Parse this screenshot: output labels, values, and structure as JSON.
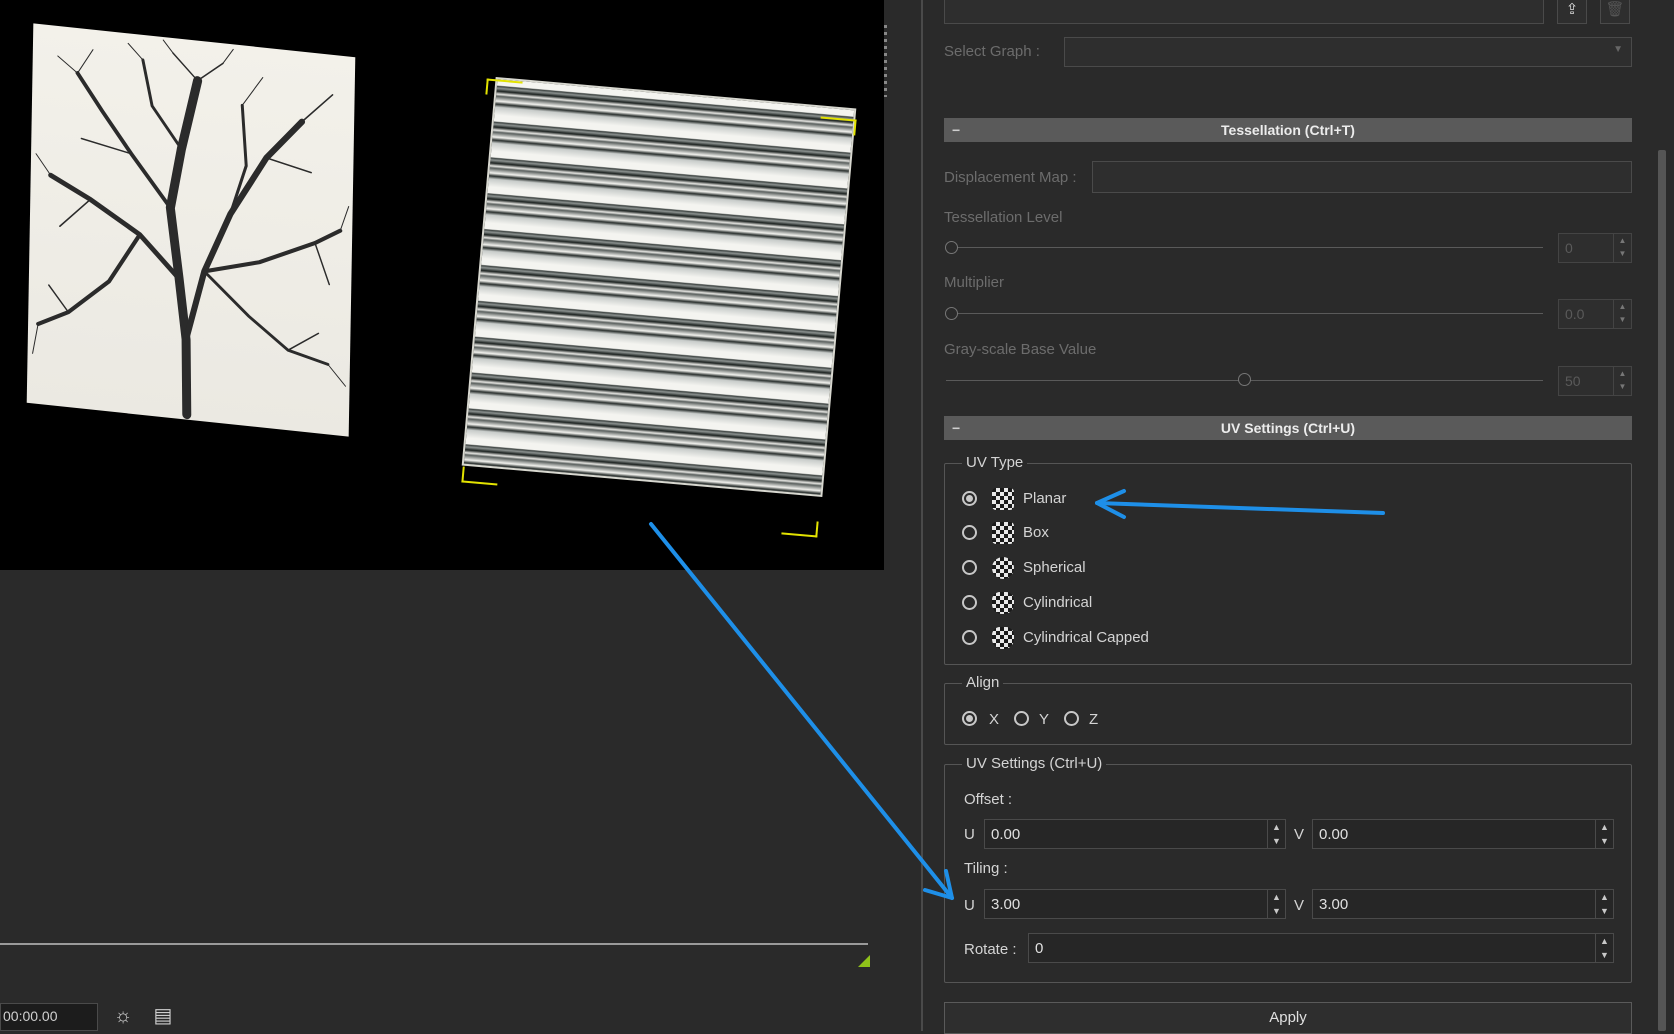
{
  "viewport": {
    "background": "#000000"
  },
  "timeline": {
    "time": "00:00.00",
    "marker_color": "#8fc21a"
  },
  "top_panel": {
    "select_graph_label": "Select Graph :"
  },
  "tessellation": {
    "header": "Tessellation  (Ctrl+T)",
    "displacement_label": "Displacement Map :",
    "level_label": "Tessellation Level",
    "level_value": "0",
    "multiplier_label": "Multiplier",
    "multiplier_value": "0.0",
    "grayscale_label": "Gray-scale Base Value",
    "grayscale_value": "50"
  },
  "uv_settings": {
    "header": "UV Settings  (Ctrl+U)",
    "uv_type_title": "UV Type",
    "uv_types": [
      {
        "label": "Planar",
        "selected": true
      },
      {
        "label": "Box",
        "selected": false
      },
      {
        "label": "Spherical",
        "selected": false
      },
      {
        "label": "Cylindrical",
        "selected": false
      },
      {
        "label": "Cylindrical Capped",
        "selected": false
      }
    ],
    "align_title": "Align",
    "align_options": [
      "X",
      "Y",
      "Z"
    ],
    "align_selected": "X",
    "group_title": "UV Settings  (Ctrl+U)",
    "offset_label": "Offset :",
    "tiling_label": "Tiling :",
    "u_label": "U",
    "v_label": "V",
    "offset_u": "0.00",
    "offset_v": "0.00",
    "tiling_u": "3.00",
    "tiling_v": "3.00",
    "rotate_label": "Rotate :",
    "rotate_value": "0"
  },
  "apply_label": "Apply",
  "annotation_color": "#1e8fe8"
}
